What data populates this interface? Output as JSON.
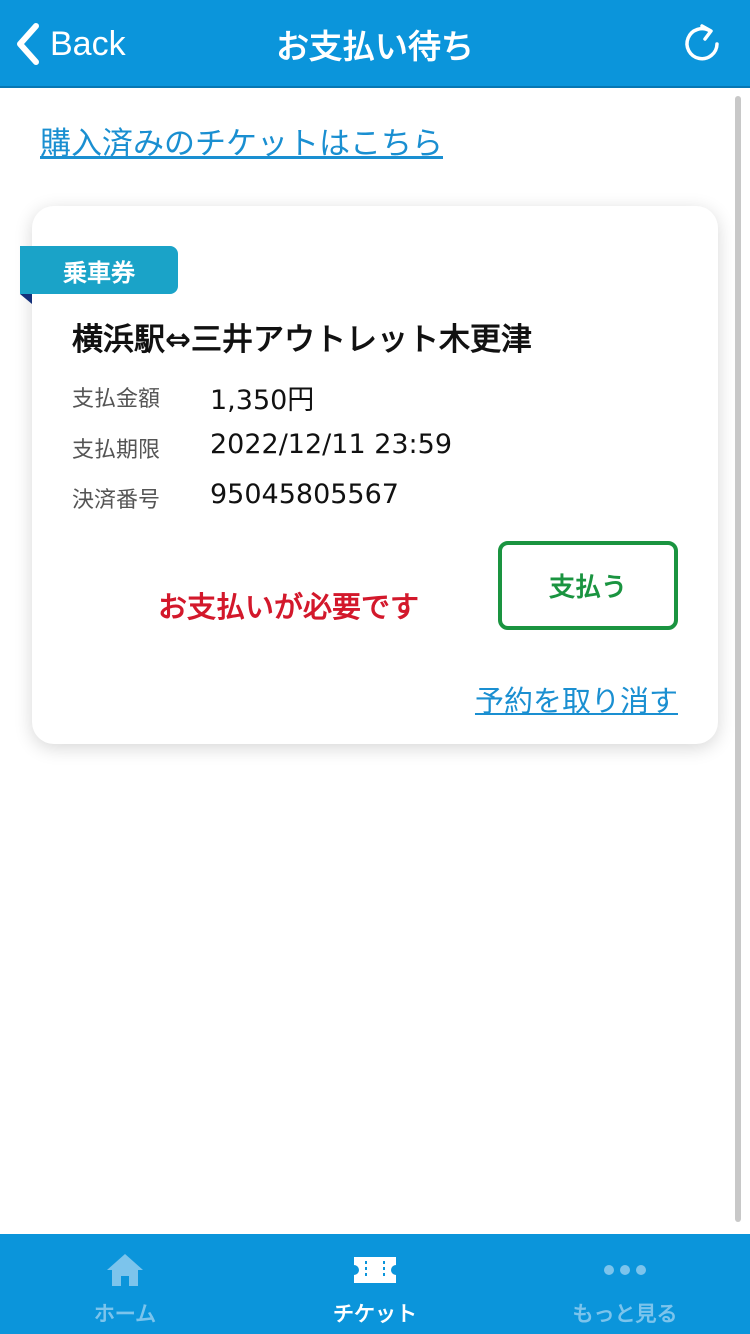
{
  "header": {
    "back_label": "Back",
    "title": "お支払い待ち",
    "icons": {
      "back": "chevron-left-icon",
      "refresh": "refresh-icon"
    }
  },
  "purchased_link": "購入済みのチケットはこちら",
  "card": {
    "ticket_type": "乗車券",
    "route": "横浜駅⇔三井アウトレット木更津",
    "rows": [
      {
        "label": "支払金額",
        "value": "1,350円"
      },
      {
        "label": "支払期限",
        "value": "2022/12/11 23:59"
      },
      {
        "label": "決済番号",
        "value": "95045805567"
      }
    ],
    "payment_required": "お支払いが必要です",
    "pay_button": "支払う",
    "cancel_link": "予約を取り消す"
  },
  "tabbar": {
    "tabs": [
      {
        "label": "ホーム",
        "icon": "home-icon",
        "active": false
      },
      {
        "label": "チケット",
        "icon": "ticket-icon",
        "active": true
      },
      {
        "label": "もっと見る",
        "icon": "more-icon",
        "active": false
      }
    ]
  },
  "colors": {
    "primary": "#0b95db",
    "link": "#1a8fd1",
    "alert": "#d3182b",
    "pay": "#1a9440",
    "ribbon": "#1aa3c8"
  }
}
